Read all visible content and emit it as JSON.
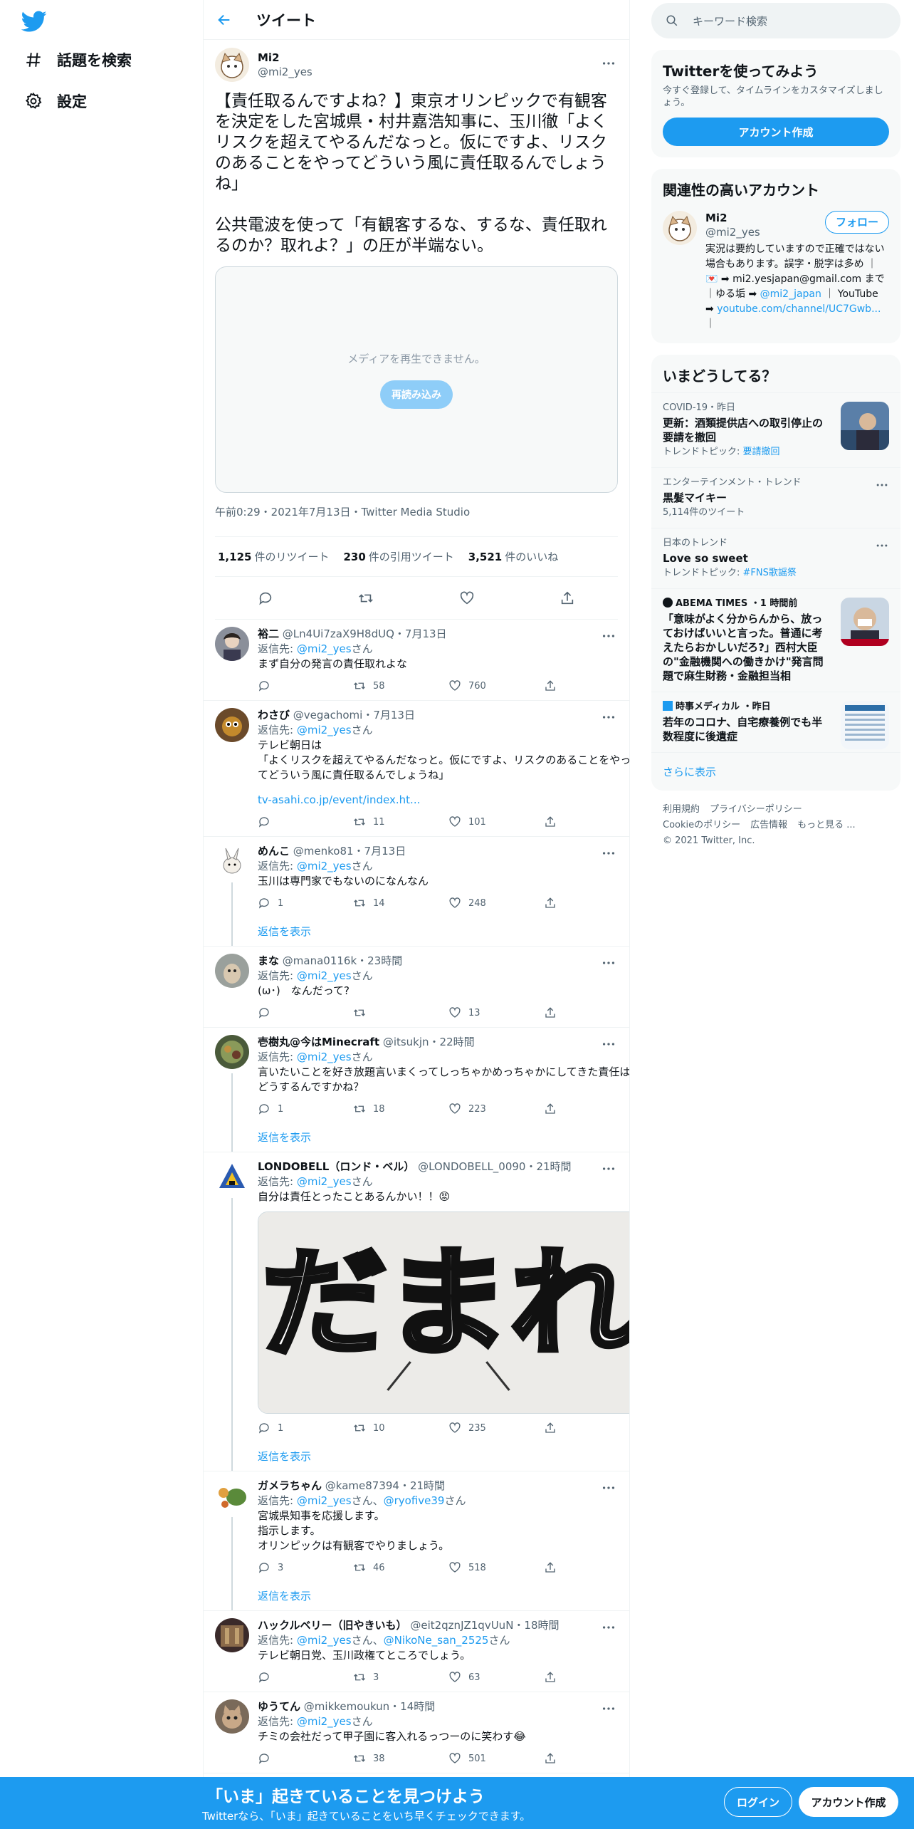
{
  "nav": {
    "items": [
      {
        "label": "話題を検索"
      },
      {
        "label": "設定"
      }
    ]
  },
  "header": {
    "title": "ツイート"
  },
  "main_tweet": {
    "name": "Mi2",
    "handle": "@mi2_yes",
    "body": "【責任取るんですよね？】東京オリンピックで有観客を決定をした宮城県・村井嘉浩知事に、玉川徹「よくリスクを超えてやるんだなっと。仮にですよ、リスクのあることをやってどういう風に責任取るんでしょうね」\n\n公共電波を使って「有観客するな、するな、責任取れるのか？取れよ？」の圧が半端ない。",
    "media_message": "メディアを再生できません。",
    "reload": "再読み込み",
    "meta": "午前0:29・2021年7月13日・Twitter Media Studio",
    "retweets_count": "1,125",
    "retweets_label": "件のリツイート",
    "quotes_count": "230",
    "quotes_label": "件の引用ツイート",
    "likes_count": "3,521",
    "likes_label": "件のいいね"
  },
  "replies": [
    {
      "name": "裕二",
      "handle": "@Ln4Ui7zaX9H8dUQ・7月13日",
      "reply_to_prefix": "返信先: ",
      "reply_to": "@mi2_yes",
      "reply_to_suffix": "さん",
      "text": "まず自分の発言の責任取れよな",
      "link": "",
      "replies": "",
      "retweets": "58",
      "likes": "760",
      "show_replies": ""
    },
    {
      "name": "わさび",
      "handle": "@vegachomi・7月13日",
      "reply_to_prefix": "返信先: ",
      "reply_to": "@mi2_yes",
      "reply_to_suffix": "さん",
      "text": "テレビ朝日は\n「よくリスクを超えてやるんだなっと。仮にですよ、リスクのあることをやってどういう風に責任取るんでしょうね」",
      "link": "tv-asahi.co.jp/event/index.ht...",
      "replies": "",
      "retweets": "11",
      "likes": "101",
      "show_replies": ""
    },
    {
      "name": "めんこ",
      "handle": "@menko81・7月13日",
      "reply_to_prefix": "返信先: ",
      "reply_to": "@mi2_yes",
      "reply_to_suffix": "さん",
      "text": "玉川は専門家でもないのになんなん",
      "link": "",
      "replies": "1",
      "retweets": "14",
      "likes": "248",
      "show_replies": "返信を表示"
    },
    {
      "name": "まな",
      "handle": "@mana0116k・23時間",
      "reply_to_prefix": "返信先: ",
      "reply_to": "@mi2_yes",
      "reply_to_suffix": "さん",
      "text": "(ω･)　なんだって?",
      "link": "",
      "replies": "",
      "retweets": "",
      "likes": "13",
      "show_replies": ""
    },
    {
      "name": "壱樹丸@今はMinecraft",
      "handle": "@itsukjn・22時間",
      "reply_to_prefix": "返信先: ",
      "reply_to": "@mi2_yes",
      "reply_to_suffix": "さん",
      "text": "言いたいことを好き放題言いまくってしっちゃかめっちゃかにしてきた責任はどうするんですかね？",
      "link": "",
      "replies": "1",
      "retweets": "18",
      "likes": "223",
      "show_replies": "返信を表示"
    },
    {
      "name": "LONDOBELL（ロンド・ベル）",
      "handle": "@LONDOBELL_0090・21時間",
      "reply_to_prefix": "返信先: ",
      "reply_to": "@mi2_yes",
      "reply_to_suffix": "さん",
      "text": "自分は責任とったことあるんかい！！😡",
      "link": "",
      "replies": "1",
      "retweets": "10",
      "likes": "235",
      "show_replies": "返信を表示",
      "image_text": "だまれ"
    },
    {
      "name": "ガメラちゃん",
      "handle": "@kame87394・21時間",
      "reply_to_prefix": "返信先: ",
      "reply_to": "@mi2_yes",
      "reply_to_suffix": "さん、",
      "reply_to2": "@ryofive39",
      "reply_to2_suffix": "さん",
      "text": "宮城県知事を応援します。\n指示します。\nオリンピックは有観客でやりましょう。",
      "link": "",
      "replies": "3",
      "retweets": "46",
      "likes": "518",
      "show_replies": "返信を表示"
    },
    {
      "name": "ハックルベリー（旧やきいも）",
      "handle": "@eit2qznJZ1qvUuN・18時間",
      "reply_to_prefix": "返信先: ",
      "reply_to": "@mi2_yes",
      "reply_to_suffix": "さん、",
      "reply_to2": "@NikoNe_san_2525",
      "reply_to2_suffix": "さん",
      "text": "テレビ朝日党、玉川政権てところでしょう。",
      "link": "",
      "replies": "",
      "retweets": "3",
      "likes": "63",
      "show_replies": ""
    },
    {
      "name": "ゆうてん",
      "handle": "@mikkemoukun・14時間",
      "reply_to_prefix": "返信先: ",
      "reply_to": "@mi2_yes",
      "reply_to_suffix": "さん",
      "text": "チミの会社だって甲子園に客入れるっつーのに笑わす😂",
      "link": "",
      "replies": "",
      "retweets": "38",
      "likes": "501",
      "show_replies": ""
    }
  ],
  "search": {
    "placeholder": "キーワード検索"
  },
  "signup": {
    "title": "Twitterを使ってみよう",
    "desc": "今すぐ登録して、タイムラインをカスタマイズしましょう。",
    "button": "アカウント作成"
  },
  "related": {
    "title": "関連性の高いアカウント",
    "name": "Mi2",
    "handle": "@mi2_yes",
    "follow": "フォロー",
    "bio1": "実況は要約していますので正確ではない場合もあります。誤字・脱字は多め ｜ 💌 ➡ mi2.yesjapan@gmail.com まで ｜ゆる垢 ➡ ",
    "bio_link1": "@mi2_japan",
    "bio2": " ｜ YouTube ➡ ",
    "bio_link2": "youtube.com/channel/UC7Gwb...",
    "bio3": " ｜"
  },
  "trends": {
    "title": "いまどうしてる？",
    "items": [
      {
        "cat": "COVID-19・昨日",
        "t": "更新：酒類提供店への取引停止の要請を撤回",
        "sub_prefix": "トレンドトピック: ",
        "sub_link": "要請撤回"
      },
      {
        "cat": "エンターテインメント・トレンド",
        "t": "黒髪マイキー",
        "sub_prefix": "5,114件のツイート",
        "sub_link": ""
      },
      {
        "cat": "日本のトレンド",
        "t": "Love so sweet",
        "sub_prefix": "トレンドトピック: ",
        "sub_link": "#FNS歌謡祭"
      },
      {
        "cat": "ABEMA TIMES ・1 時間前",
        "t": "「意味がよく分からんから、放っておけばいいと言った。普通に考えたらおかしいだろ?」西村大臣の\"金融機関への働きかけ\"発言問題で麻生財務・金融担当相",
        "sub_prefix": "",
        "sub_link": ""
      },
      {
        "cat": "時事メディカル ・昨日",
        "t": "若年のコロナ、自宅療養例でも半数程度に後遺症",
        "sub_prefix": "",
        "sub_link": ""
      }
    ],
    "more": "さらに表示"
  },
  "footer": {
    "terms": "利用規約",
    "privacy": "プライバシーポリシー",
    "cookie": "Cookieのポリシー",
    "ads": "広告情報",
    "more": "もっと見る ...",
    "copyright": "© 2021 Twitter, Inc."
  },
  "bottom": {
    "headline": "「いま」起きていることを見つけよう",
    "sub": "Twitterなら、「いま」起きていることをいち早くチェックできます。",
    "login": "ログイン",
    "signup": "アカウント作成"
  },
  "colors": {
    "accent": "#1d9bf0",
    "text": "#0f1419",
    "muted": "#536471"
  }
}
